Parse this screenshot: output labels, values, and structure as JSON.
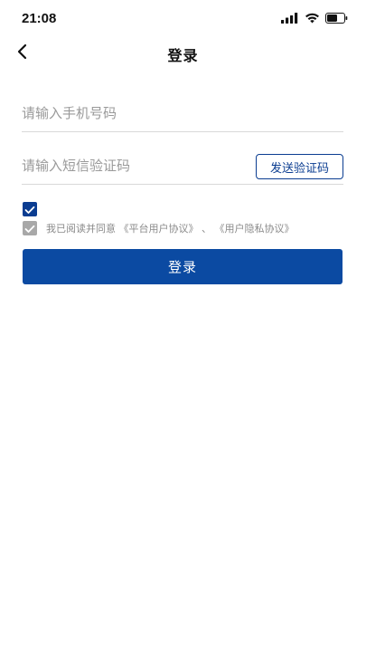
{
  "status_bar": {
    "time": "21:08",
    "icons": [
      "signal-icon",
      "wifi-icon",
      "battery-icon"
    ]
  },
  "nav": {
    "back_icon": "chevron-left-icon",
    "title": "登录"
  },
  "form": {
    "phone_placeholder": "请输入手机号码",
    "phone_value": "",
    "code_placeholder": "请输入短信验证码",
    "code_value": "",
    "send_code_label": "发送验证码",
    "checkbox_checked": true,
    "agreement": {
      "prefix": "我已阅读并同意",
      "platform_agreement": "《平台用户协议》",
      "separator": " 、",
      "privacy_agreement": "《用户隐私协议》"
    },
    "login_label": "登录"
  },
  "colors": {
    "primary": "#0b4aa2",
    "outline": "#0b3d91",
    "muted_check": "#a8a8a8"
  }
}
